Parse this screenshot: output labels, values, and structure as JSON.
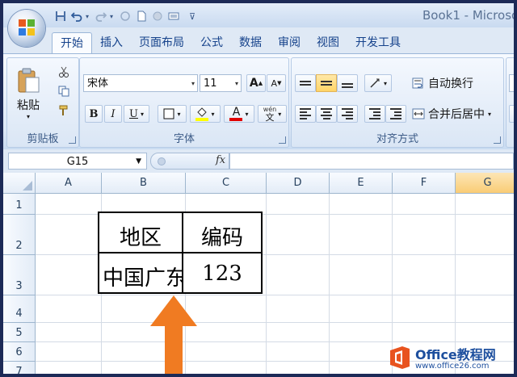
{
  "window": {
    "title": "Book1 - Microso"
  },
  "colors": {
    "accent_orange": "#f07b22",
    "selected_header": "#f9cc75",
    "ribbon_border": "#9bb6d8"
  },
  "qat": {
    "icons": [
      "save-icon",
      "undo-icon",
      "redo-icon",
      "circle-icon",
      "new-icon",
      "print-icon",
      "customize-icon"
    ]
  },
  "tabs": [
    "开始",
    "插入",
    "页面布局",
    "公式",
    "数据",
    "审阅",
    "视图",
    "开发工具"
  ],
  "ribbon": {
    "clipboard": {
      "label": "剪贴板",
      "paste": "粘贴"
    },
    "font": {
      "label": "字体",
      "font_name": "宋体",
      "font_size": "11",
      "bold": "B",
      "italic": "I",
      "underline": "U",
      "grow": "A",
      "shrink": "A",
      "font_color_letter": "A",
      "phonetic_top": "wén",
      "phonetic_bottom": "文"
    },
    "alignment": {
      "label": "对齐方式",
      "wrap_text": "自动换行",
      "merge_center": "合并后居中"
    }
  },
  "formula_bar": {
    "name_box": "G15",
    "fx": "fx",
    "value": ""
  },
  "grid": {
    "columns": [
      "A",
      "B",
      "C",
      "D",
      "E",
      "F",
      "G"
    ],
    "selected_column": "G",
    "rows": [
      "1",
      "2",
      "3",
      "4",
      "5",
      "6",
      "7"
    ],
    "table": {
      "header": [
        "地区",
        "编码"
      ],
      "row1": [
        "中国广东",
        "123"
      ]
    }
  },
  "watermark": {
    "brand": "Office教程网",
    "url": "www.office26.com"
  }
}
